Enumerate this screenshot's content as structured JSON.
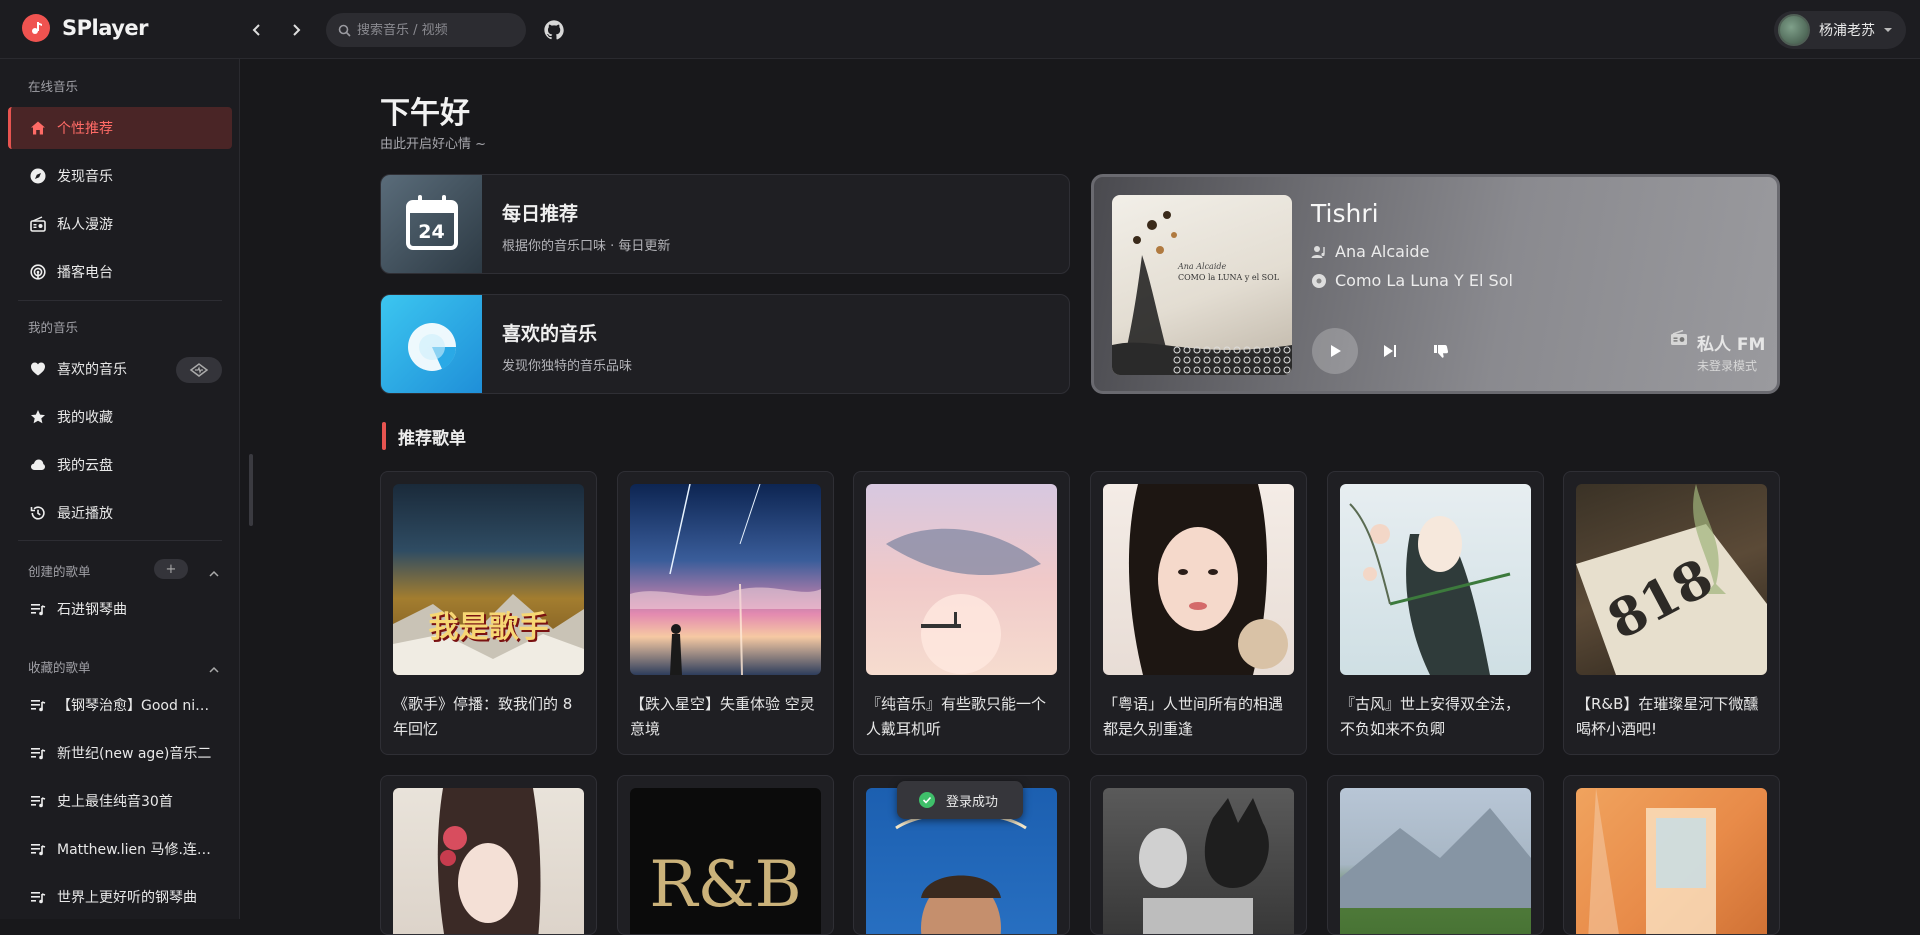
{
  "app": {
    "name": "SPlayer"
  },
  "search": {
    "placeholder": "搜索音乐 / 视频"
  },
  "user": {
    "name": "杨浦老苏"
  },
  "sidebar": {
    "online_title": "在线音乐",
    "online_items": [
      {
        "label": "个性推荐",
        "icon": "home-icon"
      },
      {
        "label": "发现音乐",
        "icon": "compass-icon"
      },
      {
        "label": "私人漫游",
        "icon": "radio-icon"
      },
      {
        "label": "播客电台",
        "icon": "podcast-icon"
      }
    ],
    "mine_title": "我的音乐",
    "mine_items": [
      {
        "label": "喜欢的音乐",
        "icon": "heart-icon"
      },
      {
        "label": "我的收藏",
        "icon": "star-icon"
      },
      {
        "label": "我的云盘",
        "icon": "cloud-icon"
      },
      {
        "label": "最近播放",
        "icon": "history-icon"
      }
    ],
    "created_title": "创建的歌单",
    "created_items": [
      {
        "label": "石进钢琴曲"
      }
    ],
    "collected_title": "收藏的歌单",
    "collected_items": [
      {
        "label": "【钢琴治愈】Good night"
      },
      {
        "label": "新世纪(new age)音乐二"
      },
      {
        "label": "史上最佳纯音30首"
      },
      {
        "label": "Matthew.lien 马修.连恩 专辑"
      },
      {
        "label": "世界上更好听的钢琴曲"
      }
    ],
    "add_symbol": "+"
  },
  "greeting": {
    "title": "下午好",
    "subtitle": "由此开启好心情 ~"
  },
  "daily": {
    "title": "每日推荐",
    "desc": "根据你的音乐口味 · 每日更新",
    "day": "24"
  },
  "liked": {
    "title": "喜欢的音乐",
    "desc": "发现你独特的音乐品味"
  },
  "fm": {
    "song": "Tishri",
    "artist": "Ana Alcaide",
    "album": "Como La Luna Y El Sol",
    "cover_line1": "Ana Alcaide",
    "cover_line2": "COMO la LUNA y el SOL",
    "label": "私人 FM",
    "sub": "未登录模式"
  },
  "section": {
    "recommended": "推荐歌单"
  },
  "playlists_row1": [
    {
      "title": "《歌手》停播：致我们的 8 年回忆",
      "cover_text": "我是歌手"
    },
    {
      "title": "【跌入星空】失重体验 空灵意境"
    },
    {
      "title": "『纯音乐』有些歌只能一个人戴耳机听"
    },
    {
      "title": "「粤语」人世间所有的相遇 都是久别重逢"
    },
    {
      "title": "『古风』世上安得双全法，不负如来不负卿"
    },
    {
      "title": "【R&B】在璀璨星河下微醺 喝杯小酒吧!",
      "cover_text": "818"
    }
  ],
  "playlists_row2": [
    {
      "title": ""
    },
    {
      "title": "",
      "cover_text": "R&B"
    },
    {
      "title": ""
    },
    {
      "title": ""
    },
    {
      "title": ""
    },
    {
      "title": ""
    }
  ],
  "toast": {
    "text": "登录成功"
  },
  "colors": {
    "accent": "#e75450",
    "background": "#18181b",
    "panel": "#1f1f23"
  }
}
